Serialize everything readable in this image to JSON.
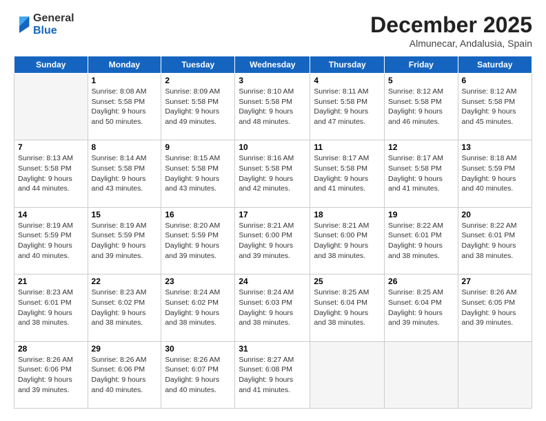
{
  "logo": {
    "general": "General",
    "blue": "Blue"
  },
  "title": "December 2025",
  "subtitle": "Almunecar, Andalusia, Spain",
  "days_header": [
    "Sunday",
    "Monday",
    "Tuesday",
    "Wednesday",
    "Thursday",
    "Friday",
    "Saturday"
  ],
  "weeks": [
    [
      {
        "day": "",
        "info": ""
      },
      {
        "day": "1",
        "info": "Sunrise: 8:08 AM\nSunset: 5:58 PM\nDaylight: 9 hours\nand 50 minutes."
      },
      {
        "day": "2",
        "info": "Sunrise: 8:09 AM\nSunset: 5:58 PM\nDaylight: 9 hours\nand 49 minutes."
      },
      {
        "day": "3",
        "info": "Sunrise: 8:10 AM\nSunset: 5:58 PM\nDaylight: 9 hours\nand 48 minutes."
      },
      {
        "day": "4",
        "info": "Sunrise: 8:11 AM\nSunset: 5:58 PM\nDaylight: 9 hours\nand 47 minutes."
      },
      {
        "day": "5",
        "info": "Sunrise: 8:12 AM\nSunset: 5:58 PM\nDaylight: 9 hours\nand 46 minutes."
      },
      {
        "day": "6",
        "info": "Sunrise: 8:12 AM\nSunset: 5:58 PM\nDaylight: 9 hours\nand 45 minutes."
      }
    ],
    [
      {
        "day": "7",
        "info": "Sunrise: 8:13 AM\nSunset: 5:58 PM\nDaylight: 9 hours\nand 44 minutes."
      },
      {
        "day": "8",
        "info": "Sunrise: 8:14 AM\nSunset: 5:58 PM\nDaylight: 9 hours\nand 43 minutes."
      },
      {
        "day": "9",
        "info": "Sunrise: 8:15 AM\nSunset: 5:58 PM\nDaylight: 9 hours\nand 43 minutes."
      },
      {
        "day": "10",
        "info": "Sunrise: 8:16 AM\nSunset: 5:58 PM\nDaylight: 9 hours\nand 42 minutes."
      },
      {
        "day": "11",
        "info": "Sunrise: 8:17 AM\nSunset: 5:58 PM\nDaylight: 9 hours\nand 41 minutes."
      },
      {
        "day": "12",
        "info": "Sunrise: 8:17 AM\nSunset: 5:58 PM\nDaylight: 9 hours\nand 41 minutes."
      },
      {
        "day": "13",
        "info": "Sunrise: 8:18 AM\nSunset: 5:59 PM\nDaylight: 9 hours\nand 40 minutes."
      }
    ],
    [
      {
        "day": "14",
        "info": "Sunrise: 8:19 AM\nSunset: 5:59 PM\nDaylight: 9 hours\nand 40 minutes."
      },
      {
        "day": "15",
        "info": "Sunrise: 8:19 AM\nSunset: 5:59 PM\nDaylight: 9 hours\nand 39 minutes."
      },
      {
        "day": "16",
        "info": "Sunrise: 8:20 AM\nSunset: 5:59 PM\nDaylight: 9 hours\nand 39 minutes."
      },
      {
        "day": "17",
        "info": "Sunrise: 8:21 AM\nSunset: 6:00 PM\nDaylight: 9 hours\nand 39 minutes."
      },
      {
        "day": "18",
        "info": "Sunrise: 8:21 AM\nSunset: 6:00 PM\nDaylight: 9 hours\nand 38 minutes."
      },
      {
        "day": "19",
        "info": "Sunrise: 8:22 AM\nSunset: 6:01 PM\nDaylight: 9 hours\nand 38 minutes."
      },
      {
        "day": "20",
        "info": "Sunrise: 8:22 AM\nSunset: 6:01 PM\nDaylight: 9 hours\nand 38 minutes."
      }
    ],
    [
      {
        "day": "21",
        "info": "Sunrise: 8:23 AM\nSunset: 6:01 PM\nDaylight: 9 hours\nand 38 minutes."
      },
      {
        "day": "22",
        "info": "Sunrise: 8:23 AM\nSunset: 6:02 PM\nDaylight: 9 hours\nand 38 minutes."
      },
      {
        "day": "23",
        "info": "Sunrise: 8:24 AM\nSunset: 6:02 PM\nDaylight: 9 hours\nand 38 minutes."
      },
      {
        "day": "24",
        "info": "Sunrise: 8:24 AM\nSunset: 6:03 PM\nDaylight: 9 hours\nand 38 minutes."
      },
      {
        "day": "25",
        "info": "Sunrise: 8:25 AM\nSunset: 6:04 PM\nDaylight: 9 hours\nand 38 minutes."
      },
      {
        "day": "26",
        "info": "Sunrise: 8:25 AM\nSunset: 6:04 PM\nDaylight: 9 hours\nand 39 minutes."
      },
      {
        "day": "27",
        "info": "Sunrise: 8:26 AM\nSunset: 6:05 PM\nDaylight: 9 hours\nand 39 minutes."
      }
    ],
    [
      {
        "day": "28",
        "info": "Sunrise: 8:26 AM\nSunset: 6:06 PM\nDaylight: 9 hours\nand 39 minutes."
      },
      {
        "day": "29",
        "info": "Sunrise: 8:26 AM\nSunset: 6:06 PM\nDaylight: 9 hours\nand 40 minutes."
      },
      {
        "day": "30",
        "info": "Sunrise: 8:26 AM\nSunset: 6:07 PM\nDaylight: 9 hours\nand 40 minutes."
      },
      {
        "day": "31",
        "info": "Sunrise: 8:27 AM\nSunset: 6:08 PM\nDaylight: 9 hours\nand 41 minutes."
      },
      {
        "day": "",
        "info": ""
      },
      {
        "day": "",
        "info": ""
      },
      {
        "day": "",
        "info": ""
      }
    ]
  ]
}
